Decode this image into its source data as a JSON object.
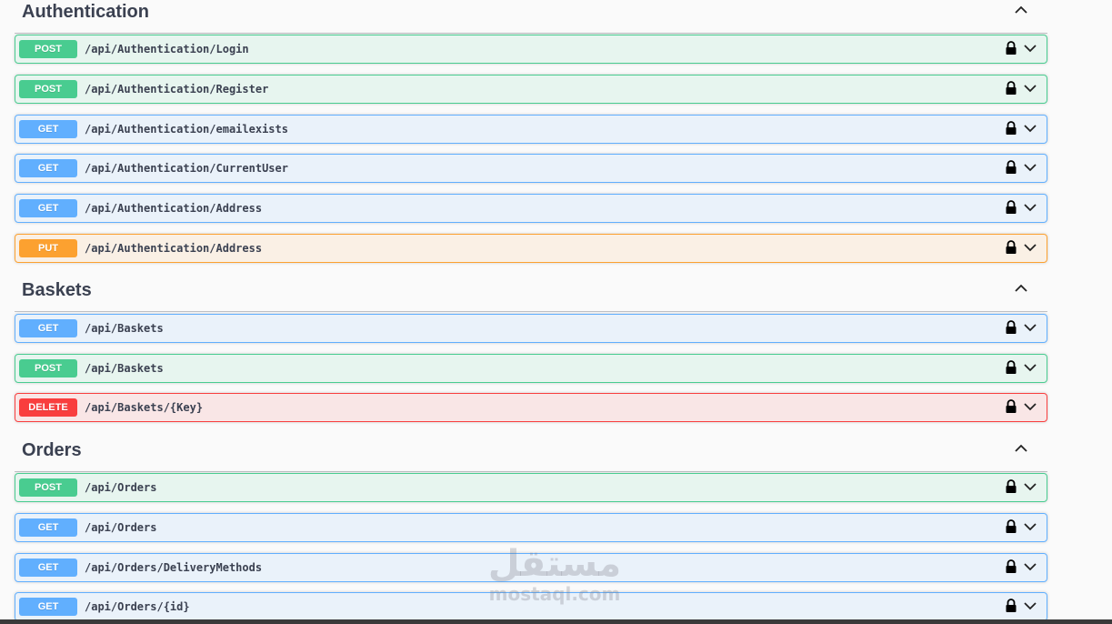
{
  "sections": [
    {
      "title": "Authentication",
      "operations": [
        {
          "method": "POST",
          "path": "/api/Authentication/Login"
        },
        {
          "method": "POST",
          "path": "/api/Authentication/Register"
        },
        {
          "method": "GET",
          "path": "/api/Authentication/emailexists"
        },
        {
          "method": "GET",
          "path": "/api/Authentication/CurrentUser"
        },
        {
          "method": "GET",
          "path": "/api/Authentication/Address"
        },
        {
          "method": "PUT",
          "path": "/api/Authentication/Address"
        }
      ]
    },
    {
      "title": "Baskets",
      "operations": [
        {
          "method": "GET",
          "path": "/api/Baskets"
        },
        {
          "method": "POST",
          "path": "/api/Baskets"
        },
        {
          "method": "DELETE",
          "path": "/api/Baskets/{Key}"
        }
      ]
    },
    {
      "title": "Orders",
      "operations": [
        {
          "method": "POST",
          "path": "/api/Orders"
        },
        {
          "method": "GET",
          "path": "/api/Orders"
        },
        {
          "method": "GET",
          "path": "/api/Orders/DeliveryMethods"
        },
        {
          "method": "GET",
          "path": "/api/Orders/{id}"
        }
      ]
    }
  ],
  "icons": {
    "section_toggle": "chevron-up-icon",
    "operation_lock": "lock-icon",
    "operation_expand": "chevron-down-icon"
  },
  "colors": {
    "post": "#49cc90",
    "get": "#61affe",
    "put": "#fca130",
    "delete": "#f93e3e"
  },
  "watermark": {
    "arabic": "مستقل",
    "latin": "mostaql.com"
  }
}
